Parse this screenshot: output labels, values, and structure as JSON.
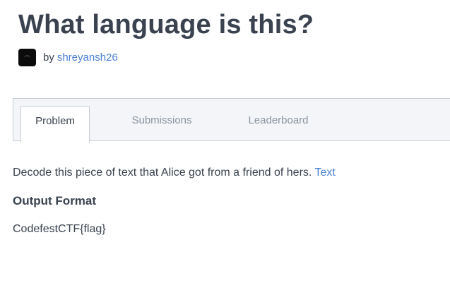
{
  "challenge": {
    "title": "What language is this?",
    "by_label": "by",
    "author": "shreyansh26"
  },
  "tabs": [
    {
      "label": "Problem",
      "active": true
    },
    {
      "label": "Submissions",
      "active": false
    },
    {
      "label": "Leaderboard",
      "active": false
    }
  ],
  "problem": {
    "description": "Decode this piece of text that Alice got from a friend of hers.",
    "link_text": "Text",
    "output_heading": "Output Format",
    "output_format": "CodefestCTF{flag}"
  },
  "colors": {
    "text": "#39424e",
    "link": "#4a7fd6",
    "tab_inactive": "#8a93a0",
    "tab_bar_bg": "#f3f5f8",
    "border": "#c7cdd6"
  },
  "icons": {
    "avatar": "author-avatar-icon"
  }
}
